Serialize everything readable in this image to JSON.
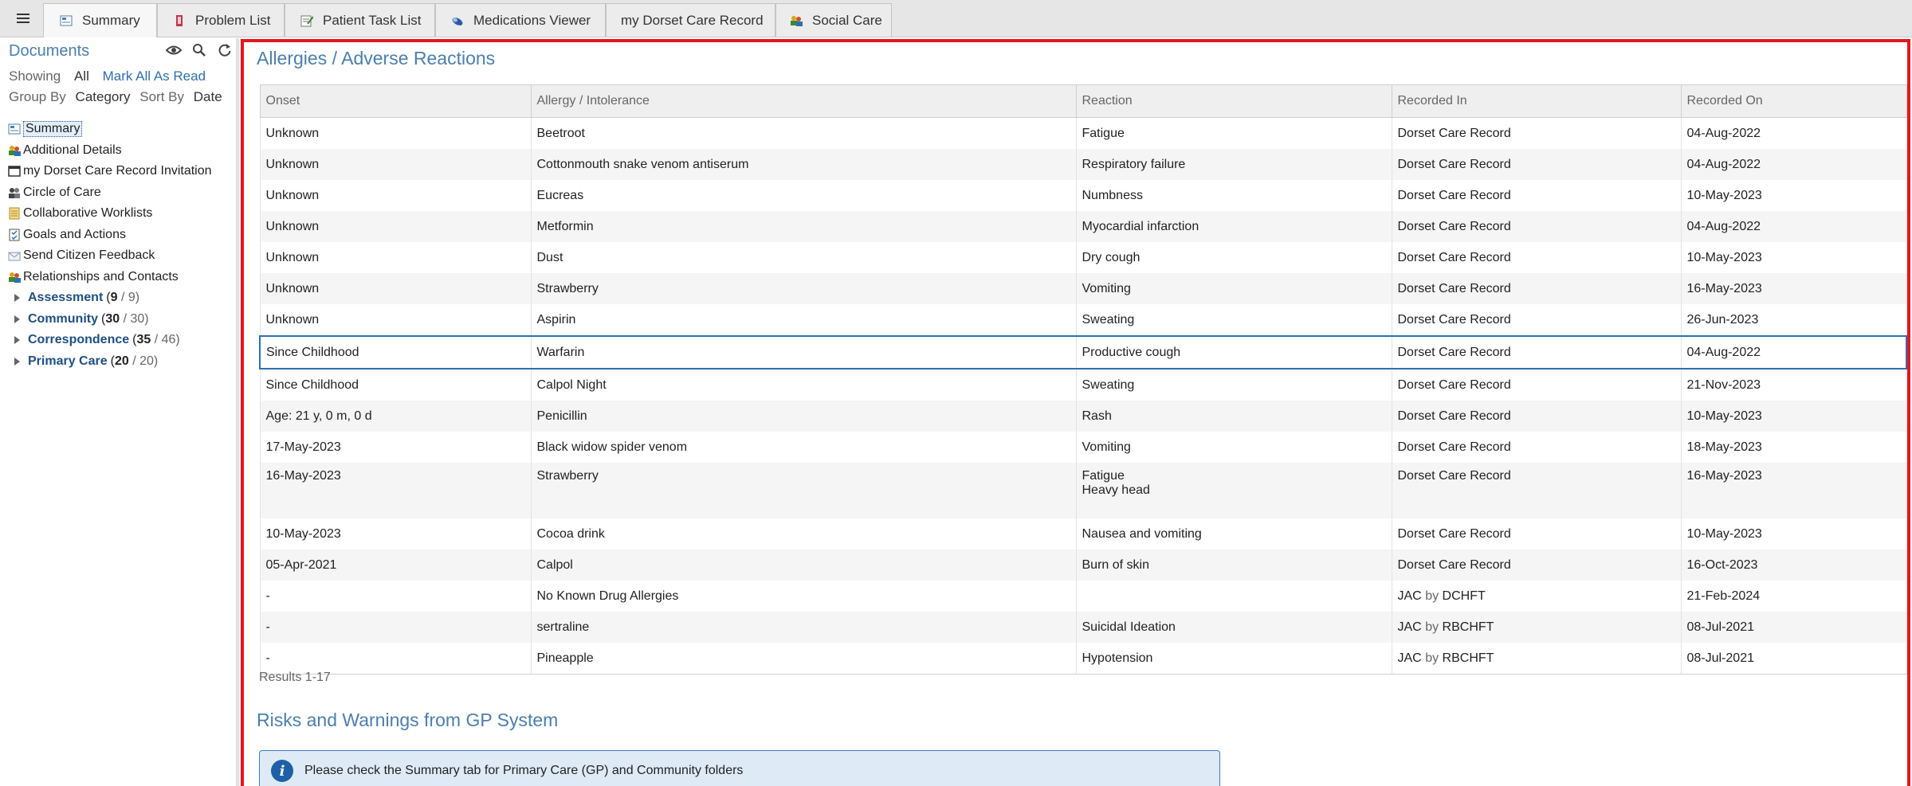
{
  "tabs": [
    {
      "label": "Summary",
      "icon": "summary-icon"
    },
    {
      "label": "Problem List",
      "icon": "problem-list-icon"
    },
    {
      "label": "Patient Task List",
      "icon": "task-list-icon"
    },
    {
      "label": "Medications Viewer",
      "icon": "pill-icon"
    },
    {
      "label": "my Dorset Care Record",
      "icon": ""
    },
    {
      "label": "Social Care",
      "icon": "people-icon"
    }
  ],
  "documents": {
    "title": "Documents",
    "showing_label": "Showing",
    "showing_value": "All",
    "mark_all_read": "Mark All As Read",
    "group_by_label": "Group By",
    "group_by_value": "Category",
    "sort_by_label": "Sort By",
    "sort_by_value": "Date",
    "items": [
      {
        "label": "Summary",
        "icon": "summary-icon"
      },
      {
        "label": "Additional Details",
        "icon": "people-icon"
      },
      {
        "label": "my Dorset Care Record Invitation",
        "icon": "window-icon"
      },
      {
        "label": "Circle of Care",
        "icon": "group-icon"
      },
      {
        "label": "Collaborative Worklists",
        "icon": "worklist-icon"
      },
      {
        "label": "Goals and Actions",
        "icon": "goals-icon"
      },
      {
        "label": "Send Citizen Feedback",
        "icon": "envelope-icon"
      },
      {
        "label": "Relationships and Contacts",
        "icon": "people-icon"
      }
    ],
    "folders": [
      {
        "name": "Assessment",
        "unread": "9",
        "total": "/ 9)",
        "open": "("
      },
      {
        "name": "Community",
        "unread": "30",
        "total": "/ 30)",
        "open": "("
      },
      {
        "name": "Correspondence",
        "unread": "35",
        "total": "/ 46)",
        "open": "("
      },
      {
        "name": "Primary Care",
        "unread": "20",
        "total": "/ 20)",
        "open": "("
      }
    ]
  },
  "allergies": {
    "title": "Allergies / Adverse Reactions",
    "columns": [
      "Onset",
      "Allergy / Intolerance",
      "Reaction",
      "Recorded In",
      "Recorded On"
    ],
    "rows": [
      {
        "onset": "Unknown",
        "allergy": "Beetroot",
        "reaction": "Fatigue",
        "reaction2": "",
        "recorded_in": "Dorset Care Record",
        "by": "",
        "org": "",
        "recorded_on": "04-Aug-2022"
      },
      {
        "onset": "Unknown",
        "allergy": "Cottonmouth snake venom antiserum",
        "reaction": "Respiratory failure",
        "reaction2": "",
        "recorded_in": "Dorset Care Record",
        "by": "",
        "org": "",
        "recorded_on": "04-Aug-2022"
      },
      {
        "onset": "Unknown",
        "allergy": "Eucreas",
        "reaction": "Numbness",
        "reaction2": "",
        "recorded_in": "Dorset Care Record",
        "by": "",
        "org": "",
        "recorded_on": "10-May-2023"
      },
      {
        "onset": "Unknown",
        "allergy": "Metformin",
        "reaction": "Myocardial infarction",
        "reaction2": "",
        "recorded_in": "Dorset Care Record",
        "by": "",
        "org": "",
        "recorded_on": "04-Aug-2022"
      },
      {
        "onset": "Unknown",
        "allergy": "Dust",
        "reaction": "Dry cough",
        "reaction2": "",
        "recorded_in": "Dorset Care Record",
        "by": "",
        "org": "",
        "recorded_on": "10-May-2023"
      },
      {
        "onset": "Unknown",
        "allergy": "Strawberry",
        "reaction": "Vomiting",
        "reaction2": "",
        "recorded_in": "Dorset Care Record",
        "by": "",
        "org": "",
        "recorded_on": "16-May-2023"
      },
      {
        "onset": "Unknown",
        "allergy": "Aspirin",
        "reaction": "Sweating",
        "reaction2": "",
        "recorded_in": "Dorset Care Record",
        "by": "",
        "org": "",
        "recorded_on": "26-Jun-2023"
      },
      {
        "onset": "Since Childhood",
        "allergy": "Warfarin",
        "reaction": "Productive cough",
        "reaction2": "",
        "recorded_in": "Dorset Care Record",
        "by": "",
        "org": "",
        "recorded_on": "04-Aug-2022"
      },
      {
        "onset": "Since Childhood",
        "allergy": "Calpol Night",
        "reaction": "Sweating",
        "reaction2": "",
        "recorded_in": "Dorset Care Record",
        "by": "",
        "org": "",
        "recorded_on": "21-Nov-2023"
      },
      {
        "onset": "Age: 21 y, 0 m, 0 d",
        "allergy": "Penicillin",
        "reaction": "Rash",
        "reaction2": "",
        "recorded_in": "Dorset Care Record",
        "by": "",
        "org": "",
        "recorded_on": "10-May-2023"
      },
      {
        "onset": "17-May-2023",
        "allergy": "Black widow spider venom",
        "reaction": "Vomiting",
        "reaction2": "",
        "recorded_in": "Dorset Care Record",
        "by": "",
        "org": "",
        "recorded_on": "18-May-2023"
      },
      {
        "onset": "16-May-2023",
        "allergy": "Strawberry",
        "reaction": "Fatigue",
        "reaction2": "Heavy head",
        "recorded_in": "Dorset Care Record",
        "by": "",
        "org": "",
        "recorded_on": "16-May-2023"
      },
      {
        "onset": "10-May-2023",
        "allergy": "Cocoa drink",
        "reaction": "Nausea and vomiting",
        "reaction2": "",
        "recorded_in": "Dorset Care Record",
        "by": "",
        "org": "",
        "recorded_on": "10-May-2023"
      },
      {
        "onset": "05-Apr-2021",
        "allergy": "Calpol",
        "reaction": "Burn of skin",
        "reaction2": "",
        "recorded_in": "Dorset Care Record",
        "by": "",
        "org": "",
        "recorded_on": "16-Oct-2023"
      },
      {
        "onset": "-",
        "allergy": "No Known Drug Allergies",
        "reaction": "",
        "reaction2": "",
        "recorded_in": "JAC",
        "by": "by",
        "org": "DCHFT",
        "recorded_on": "21-Feb-2024"
      },
      {
        "onset": "-",
        "allergy": "sertraline",
        "reaction": "Suicidal Ideation",
        "reaction2": "",
        "recorded_in": "JAC",
        "by": "by",
        "org": "RBCHFT",
        "recorded_on": "08-Jul-2021"
      },
      {
        "onset": "-",
        "allergy": "Pineapple",
        "reaction": "Hypotension",
        "reaction2": "",
        "recorded_in": "JAC",
        "by": "by",
        "org": "RBCHFT",
        "recorded_on": "08-Jul-2021"
      }
    ],
    "results": "Results 1-17"
  },
  "risks": {
    "title": "Risks and Warnings from GP System",
    "info_message": "Please check the Summary tab for Primary Care (GP) and Community folders"
  },
  "colors": {
    "accent": "#4a7fb0",
    "highlight_border": "#e8161c",
    "selection": "#2d6fb5"
  }
}
